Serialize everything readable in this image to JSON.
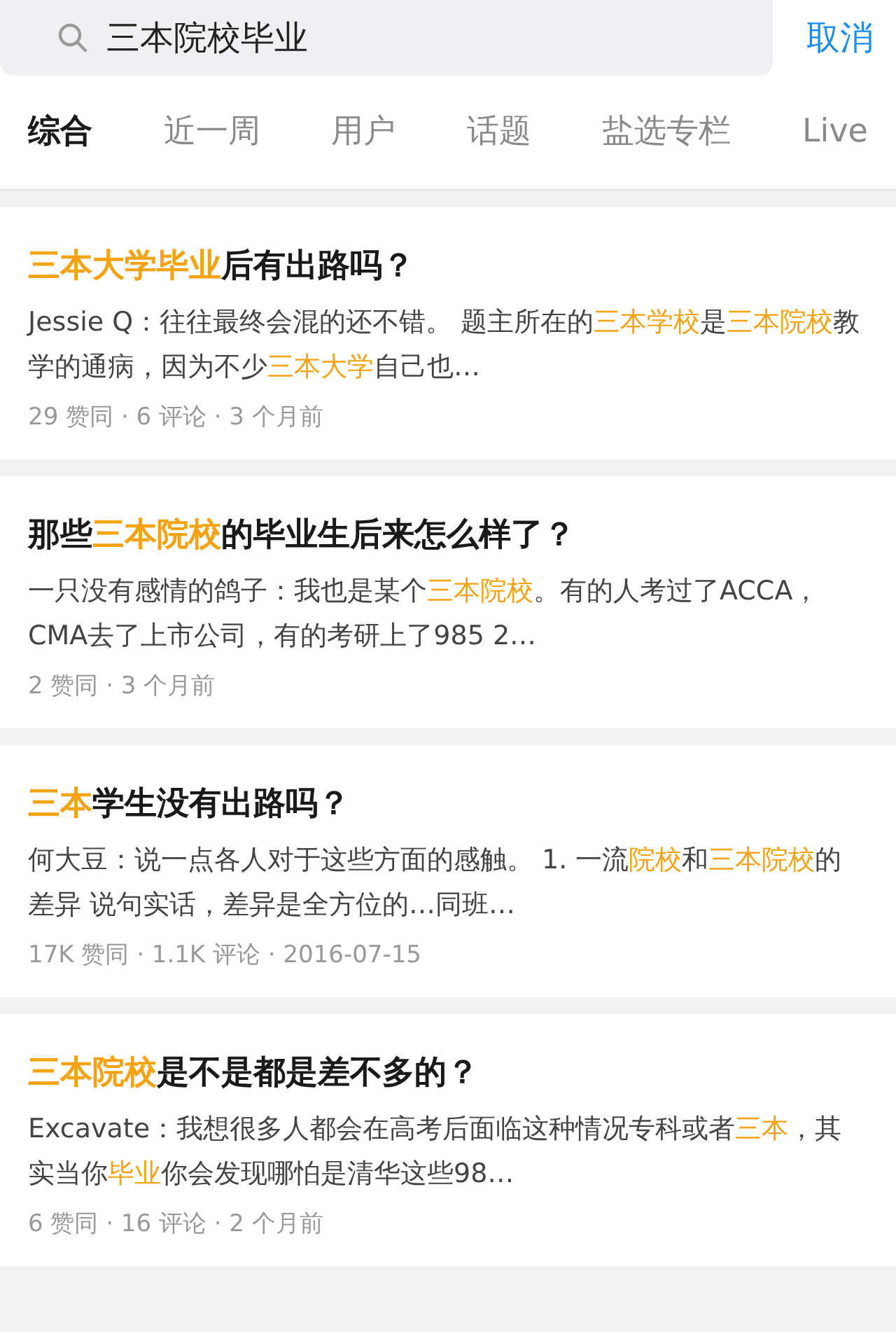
{
  "search": {
    "value": "三本院校毕业",
    "cancel": "取消"
  },
  "tabs": [
    {
      "label": "综合",
      "selected": true
    },
    {
      "label": "近一周",
      "selected": false
    },
    {
      "label": "用户",
      "selected": false
    },
    {
      "label": "话题",
      "selected": false
    },
    {
      "label": "盐选专栏",
      "selected": false
    },
    {
      "label": "Live",
      "selected": false
    }
  ],
  "results": [
    {
      "title": [
        {
          "text": "三本大学毕业",
          "highlight": true
        },
        {
          "text": "后有出路吗？",
          "highlight": false
        }
      ],
      "snippet": [
        {
          "text": "Jessie Q：往往最终会混的还不错。 题主所在的",
          "highlight": false
        },
        {
          "text": "三本学校",
          "highlight": true
        },
        {
          "text": "是",
          "highlight": false
        },
        {
          "text": "三本院校",
          "highlight": true
        },
        {
          "text": "教学的通病，因为不少",
          "highlight": false
        },
        {
          "text": "三本大学",
          "highlight": true
        },
        {
          "text": "自己也…",
          "highlight": false
        }
      ],
      "meta": "29 赞同 · 6 评论 · 3 个月前"
    },
    {
      "title": [
        {
          "text": "那些",
          "highlight": false
        },
        {
          "text": "三本院校",
          "highlight": true
        },
        {
          "text": "的毕业生后来怎么样了？",
          "highlight": false
        }
      ],
      "snippet": [
        {
          "text": "一只没有感情的鸽子：我也是某个",
          "highlight": false
        },
        {
          "text": "三本院校",
          "highlight": true
        },
        {
          "text": "。有的人考过了ACCA，CMA去了上市公司，有的考研上了985 2…",
          "highlight": false
        }
      ],
      "meta": "2 赞同 · 3 个月前"
    },
    {
      "title": [
        {
          "text": "三本",
          "highlight": true
        },
        {
          "text": "学生没有出路吗？",
          "highlight": false
        }
      ],
      "snippet": [
        {
          "text": "何大豆：说一点各人对于这些方面的感触。 1. 一流",
          "highlight": false
        },
        {
          "text": "院校",
          "highlight": true
        },
        {
          "text": "和",
          "highlight": false
        },
        {
          "text": "三本院校",
          "highlight": true
        },
        {
          "text": "的差异 说句实话，差异是全方位的…同班…",
          "highlight": false
        }
      ],
      "meta": "17K 赞同 · 1.1K 评论 · 2016-07-15"
    },
    {
      "title": [
        {
          "text": "三本院校",
          "highlight": true
        },
        {
          "text": "是不是都是差不多的？",
          "highlight": false
        }
      ],
      "snippet": [
        {
          "text": "Excavate：我想很多人都会在高考后面临这种情况专科或者",
          "highlight": false
        },
        {
          "text": "三本",
          "highlight": true
        },
        {
          "text": "，其实当你",
          "highlight": false
        },
        {
          "text": "毕业",
          "highlight": true
        },
        {
          "text": "你会发现哪怕是清华这些98…",
          "highlight": false
        }
      ],
      "meta": "6 赞同 · 16 评论 · 2 个月前"
    }
  ]
}
